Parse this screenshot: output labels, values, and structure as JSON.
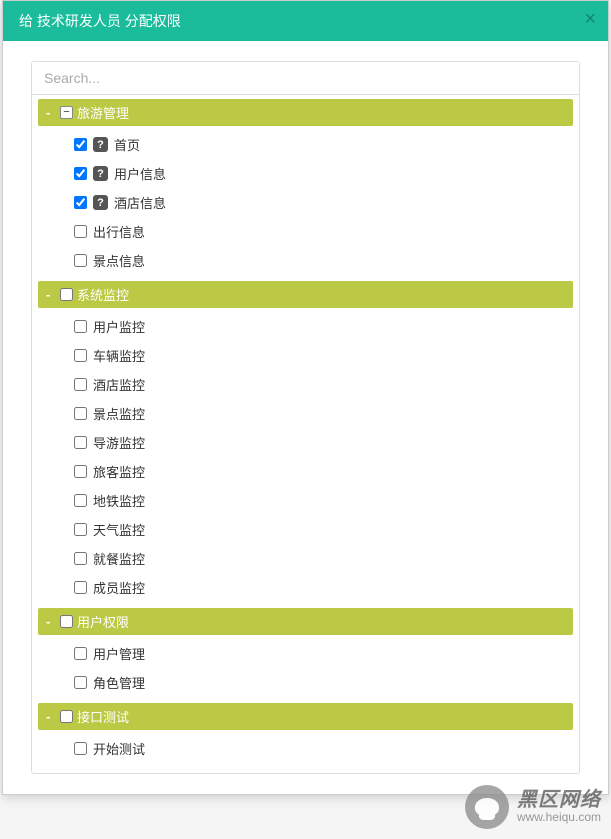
{
  "modal": {
    "title": "给 技术研发人员 分配权限",
    "search_placeholder": "Search..."
  },
  "tree": {
    "groups": [
      {
        "label": "旅游管理",
        "checked": "indeterminate",
        "children": [
          {
            "label": "首页",
            "checked": true,
            "help": true
          },
          {
            "label": "用户信息",
            "checked": true,
            "help": true
          },
          {
            "label": "酒店信息",
            "checked": true,
            "help": true
          },
          {
            "label": "出行信息",
            "checked": false,
            "help": false
          },
          {
            "label": "景点信息",
            "checked": false,
            "help": false
          }
        ]
      },
      {
        "label": "系统监控",
        "checked": false,
        "children": [
          {
            "label": "用户监控",
            "checked": false,
            "help": false
          },
          {
            "label": "车辆监控",
            "checked": false,
            "help": false
          },
          {
            "label": "酒店监控",
            "checked": false,
            "help": false
          },
          {
            "label": "景点监控",
            "checked": false,
            "help": false
          },
          {
            "label": "导游监控",
            "checked": false,
            "help": false
          },
          {
            "label": "旅客监控",
            "checked": false,
            "help": false
          },
          {
            "label": "地铁监控",
            "checked": false,
            "help": false
          },
          {
            "label": "天气监控",
            "checked": false,
            "help": false
          },
          {
            "label": "就餐监控",
            "checked": false,
            "help": false
          },
          {
            "label": "成员监控",
            "checked": false,
            "help": false
          }
        ]
      },
      {
        "label": "用户权限",
        "checked": false,
        "children": [
          {
            "label": "用户管理",
            "checked": false,
            "help": false
          },
          {
            "label": "角色管理",
            "checked": false,
            "help": false
          }
        ]
      },
      {
        "label": "接口测试",
        "checked": false,
        "children": [
          {
            "label": "开始测试",
            "checked": false,
            "help": false
          }
        ]
      }
    ]
  },
  "watermark": {
    "main": "黑区网络",
    "sub": "www.heiqu.com"
  }
}
